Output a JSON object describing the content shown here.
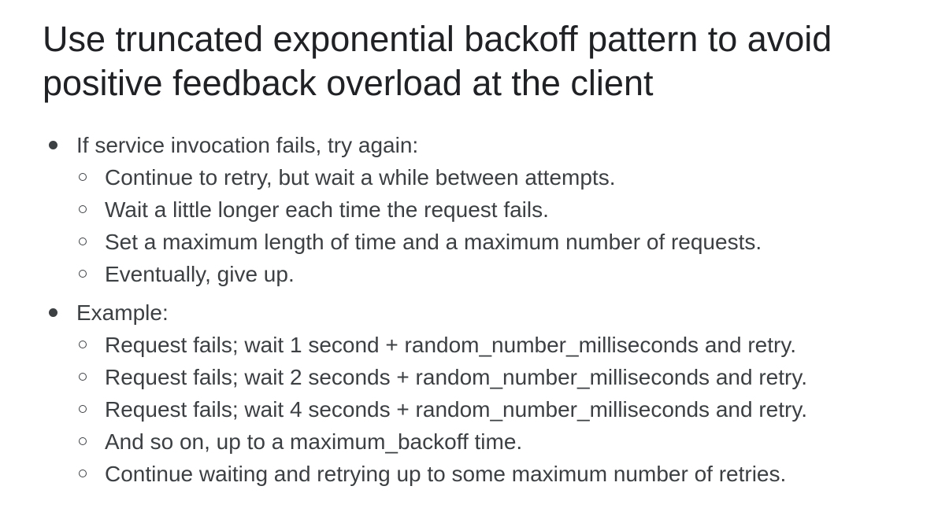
{
  "slide": {
    "title_line1": "Use truncated exponential backoff pattern to avoid",
    "title_line2": "positive feedback overload at the client",
    "bullets": [
      {
        "text": "If service invocation fails, try again:",
        "subitems": [
          "Continue to retry, but wait a while between attempts.",
          "Wait a little longer each time the request fails.",
          "Set a maximum length of time and a maximum number of requests.",
          "Eventually, give up."
        ]
      },
      {
        "text": "Example:",
        "subitems": [
          "Request fails; wait 1 second + random_number_milliseconds and retry.",
          "Request fails; wait 2 seconds + random_number_milliseconds and retry.",
          "Request fails; wait 4 seconds + random_number_milliseconds and retry.",
          "And so on, up to a maximum_backoff time.",
          "Continue waiting and retrying up to some maximum number of retries."
        ]
      }
    ]
  }
}
